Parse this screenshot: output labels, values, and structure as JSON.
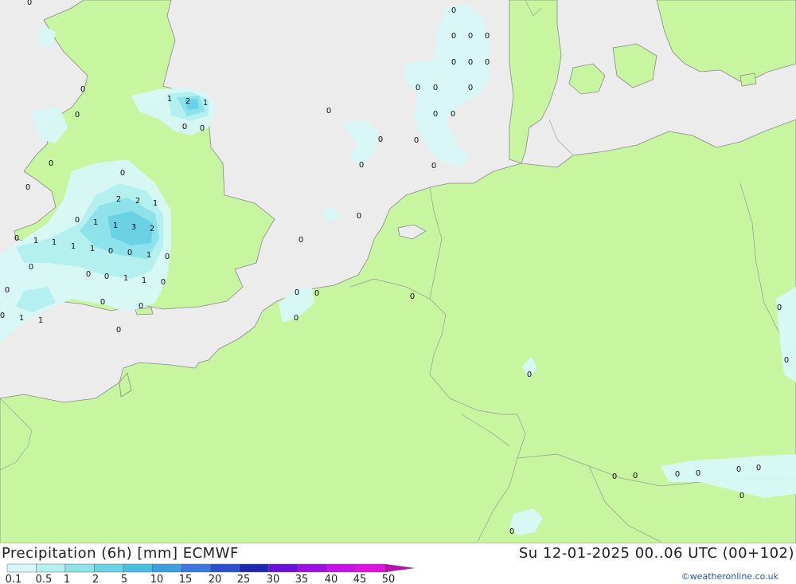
{
  "title": "Precipitation (6h) [mm] ECMWF",
  "datetime": "Su 12-01-2025 00..06 UTC (00+102)",
  "credit": "©weatheronline.co.uk",
  "colors": {
    "sea": "#ececec",
    "land": "#c8f5a0",
    "coast": "#8a8a8a",
    "border": "#9a9a9a"
  },
  "legend": {
    "ticks": [
      "0.1",
      "0.5",
      "1",
      "2",
      "5",
      "10",
      "15",
      "20",
      "25",
      "30",
      "35",
      "40",
      "45",
      "50"
    ],
    "colors": [
      "#d8f8f8",
      "#b4f0f0",
      "#8ee2ea",
      "#6ad2e4",
      "#48bee0",
      "#3aa0e0",
      "#3a78e0",
      "#2a50d0",
      "#1c28b0",
      "#6a10d8",
      "#9a10e0",
      "#c810e8",
      "#e010e0",
      "#b810b0"
    ]
  },
  "point_values": [
    "0",
    "1",
    "2",
    "3"
  ]
}
